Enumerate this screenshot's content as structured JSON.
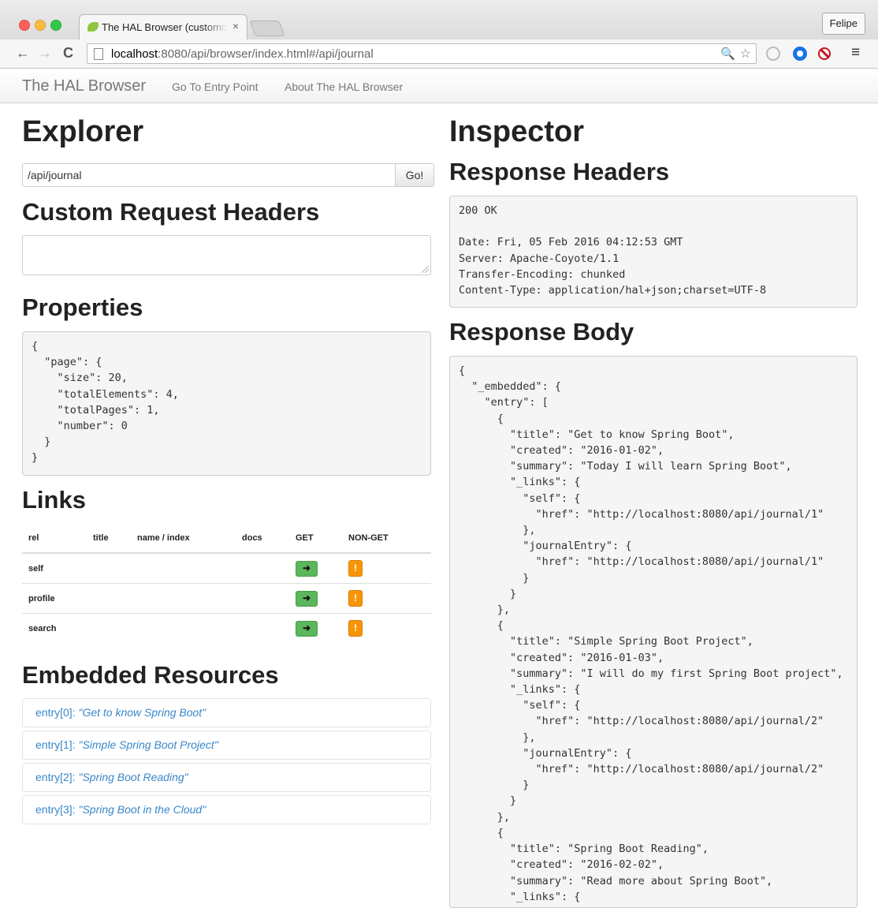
{
  "browser": {
    "tab_title": "The HAL Browser (customiz",
    "tab_close": "×",
    "user_name": "Felipe",
    "url_host": "localhost",
    "url_rest": ":8080/api/browser/index.html#/api/journal",
    "back_icon": "←",
    "forward_icon": "→",
    "reload_icon": "C",
    "zoom_icon": "🔍",
    "star_icon": "☆",
    "menu_icon": "≡"
  },
  "appnav": {
    "brand": "The HAL Browser",
    "links": [
      "Go To Entry Point",
      "About The HAL Browser"
    ]
  },
  "explorer": {
    "title": "Explorer",
    "url_value": "/api/journal",
    "go_label": "Go!",
    "custom_headers_title": "Custom Request Headers",
    "custom_headers_value": "",
    "properties_title": "Properties",
    "properties_json": "{\n  \"page\": {\n    \"size\": 20,\n    \"totalElements\": 4,\n    \"totalPages\": 1,\n    \"number\": 0\n  }\n}",
    "links_title": "Links",
    "links_columns": [
      "rel",
      "title",
      "name / index",
      "docs",
      "GET",
      "NON-GET"
    ],
    "links_rows": [
      {
        "rel": "self",
        "title": "",
        "name": "",
        "docs": ""
      },
      {
        "rel": "profile",
        "title": "",
        "name": "",
        "docs": ""
      },
      {
        "rel": "search",
        "title": "",
        "name": "",
        "docs": ""
      }
    ],
    "get_glyph": "➜",
    "nonget_glyph": "!",
    "embedded_title": "Embedded Resources",
    "embedded": [
      {
        "key": "entry[0]: ",
        "title": "\"Get to know Spring Boot\""
      },
      {
        "key": "entry[1]: ",
        "title": "\"Simple Spring Boot Project\""
      },
      {
        "key": "entry[2]: ",
        "title": "\"Spring Boot Reading\""
      },
      {
        "key": "entry[3]: ",
        "title": "\"Spring Boot in the Cloud\""
      }
    ]
  },
  "inspector": {
    "title": "Inspector",
    "response_headers_title": "Response Headers",
    "response_headers_text": "200 OK\n\nDate: Fri, 05 Feb 2016 04:12:53 GMT\nServer: Apache-Coyote/1.1\nTransfer-Encoding: chunked\nContent-Type: application/hal+json;charset=UTF-8",
    "response_body_title": "Response Body",
    "response_body_text": "{\n  \"_embedded\": {\n    \"entry\": [\n      {\n        \"title\": \"Get to know Spring Boot\",\n        \"created\": \"2016-01-02\",\n        \"summary\": \"Today I will learn Spring Boot\",\n        \"_links\": {\n          \"self\": {\n            \"href\": \"http://localhost:8080/api/journal/1\"\n          },\n          \"journalEntry\": {\n            \"href\": \"http://localhost:8080/api/journal/1\"\n          }\n        }\n      },\n      {\n        \"title\": \"Simple Spring Boot Project\",\n        \"created\": \"2016-01-03\",\n        \"summary\": \"I will do my first Spring Boot project\",\n        \"_links\": {\n          \"self\": {\n            \"href\": \"http://localhost:8080/api/journal/2\"\n          },\n          \"journalEntry\": {\n            \"href\": \"http://localhost:8080/api/journal/2\"\n          }\n        }\n      },\n      {\n        \"title\": \"Spring Boot Reading\",\n        \"created\": \"2016-02-02\",\n        \"summary\": \"Read more about Spring Boot\",\n        \"_links\": {"
  }
}
